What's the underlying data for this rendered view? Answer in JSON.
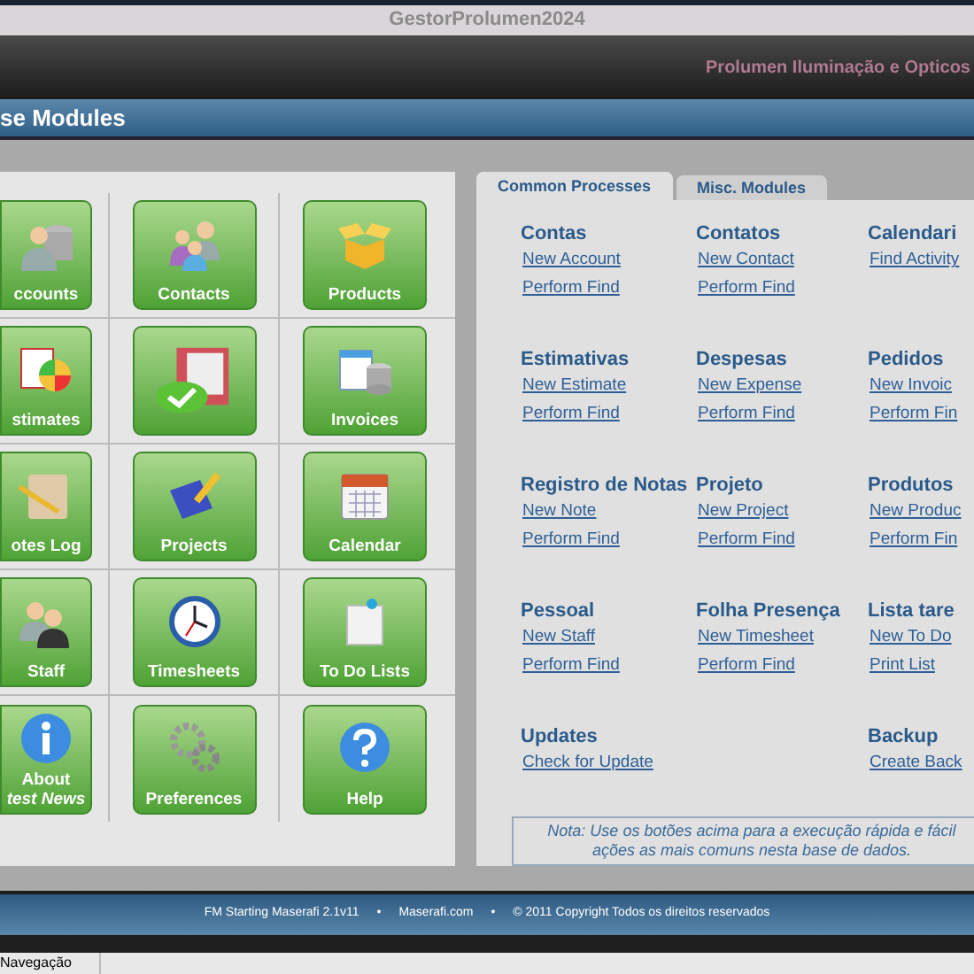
{
  "window": {
    "title": "GestorProlumen2024"
  },
  "company": "Prolumen Iluminação e Opticos",
  "header": {
    "title": "se Modules"
  },
  "tiles": [
    {
      "label": "ccounts"
    },
    {
      "label": "Contacts"
    },
    {
      "label": "Products"
    },
    {
      "label": "stimates"
    },
    {
      "kind": "icon_only"
    },
    {
      "label": "Invoices"
    },
    {
      "label": "otes Log"
    },
    {
      "label": "Projects"
    },
    {
      "label": "Calendar"
    },
    {
      "label": "Staff"
    },
    {
      "label": "Timesheets"
    },
    {
      "label": "To Do Lists"
    },
    {
      "label": "About",
      "sublabel": "test News"
    },
    {
      "label": "Preferences"
    },
    {
      "label": "Help"
    }
  ],
  "tabs": [
    {
      "label": "Common Processes",
      "selected": true
    },
    {
      "label": "Misc. Modules",
      "selected": false
    }
  ],
  "sections": [
    {
      "title": "Contas",
      "links": [
        "New Account",
        "Perform Find"
      ]
    },
    {
      "title": "Contatos",
      "links": [
        "New Contact",
        "Perform Find"
      ]
    },
    {
      "title": "Calendari",
      "links": [
        "Find Activity"
      ]
    },
    {
      "title": "Estimativas",
      "links": [
        "New Estimate",
        "Perform Find"
      ]
    },
    {
      "title": "Despesas",
      "links": [
        "New Expense",
        "Perform Find"
      ]
    },
    {
      "title": "Pedidos",
      "links": [
        "New Invoic",
        "Perform Fin"
      ]
    },
    {
      "title": "Registro de Notas",
      "links": [
        "New Note",
        "Perform Find"
      ]
    },
    {
      "title": "Projeto",
      "links": [
        "New Project",
        "Perform Find"
      ]
    },
    {
      "title": "Produtos",
      "links": [
        "New Produc",
        "Perform Fin"
      ]
    },
    {
      "title": "Pessoal",
      "links": [
        "New Staff",
        "Perform Find"
      ]
    },
    {
      "title": "Folha Presença",
      "links": [
        "New Timesheet",
        "Perform Find"
      ]
    },
    {
      "title": "Lista tare",
      "links": [
        "New To Do",
        "Print List"
      ]
    }
  ],
  "updates": {
    "title": "Updates",
    "links": [
      "Check for Update"
    ]
  },
  "backup": {
    "title": "Backup",
    "links": [
      "Create Back"
    ]
  },
  "note": [
    "Nota: Use os botões acima para a execução rápida e fácil",
    "ações as mais comuns nesta base de dados."
  ],
  "footer": [
    "FM Starting Maserafi 2.1v11",
    "•",
    "Maserafi.com",
    "•",
    "© 2011 Copyright Todos os direitos reservados"
  ],
  "status_bar": {
    "label": "Navegação"
  }
}
